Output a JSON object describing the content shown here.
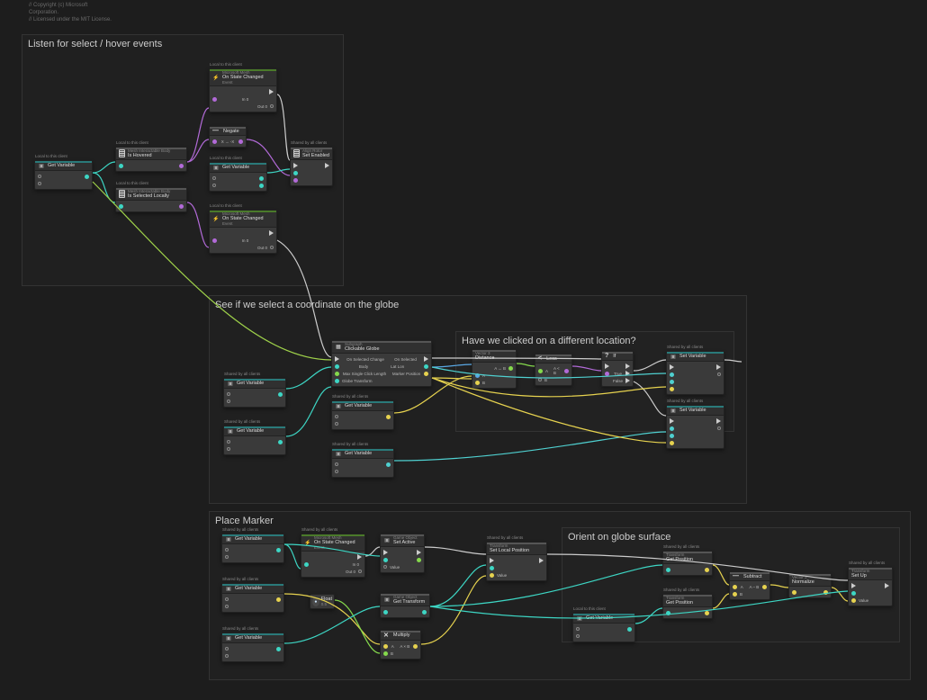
{
  "comments": [
    "// Copyright (c) Microsoft",
    "Corporation.",
    "// Licensed under the MIT License."
  ],
  "groups": {
    "g1": "Listen for select / hover events",
    "g2": "See if we select a coordinate on the globe",
    "g3": "Have we clicked on a different location?",
    "g4": "Place Marker",
    "g5": "Orient on globe surface"
  },
  "tags": {
    "local": "Local to this client",
    "shared": "Shared by all clients"
  },
  "nodes": {
    "onStateChanged": {
      "category": "Microsoft Mesh",
      "title": "On State Changed",
      "sub": "Event",
      "in": "In 0",
      "out": "Out 0"
    },
    "getVariable": "Get Variable",
    "setVariable": "Set Variable",
    "isHovered": {
      "category": "Mesh Interactable Body",
      "title": "Is Hovered"
    },
    "isSelectedLocally": {
      "category": "Mesh Interactable Body",
      "title": "Is Selected Locally"
    },
    "negate": {
      "title": "Negate",
      "sub": "X   → -X"
    },
    "setEnabled": {
      "category": "Align Rotor",
      "title": "Set Enabled"
    },
    "clickableGlobe": {
      "category": "Subgraph",
      "title": "Clickable Globe",
      "ports": {
        "onSelectedChange": "On Selected Change",
        "body": "Body",
        "maxSingleClickLength": "Max Single Click Length",
        "globeTransform": "Globe Transform",
        "onSelected": "On Selected",
        "latLon": "Lat Lon",
        "markerPosition": "Marker Position"
      }
    },
    "distance": {
      "category": "Vector 3",
      "title": "Distance",
      "a": "A",
      "b": "B",
      "out": "A ↔ B"
    },
    "less": {
      "title": "Less",
      "a": "A",
      "b": "B",
      "out": "A < B"
    },
    "if": {
      "title": "If",
      "true": "True",
      "false": "False"
    },
    "float": {
      "title": "Float",
      "value": "0.5"
    },
    "setActive": {
      "category": "Game Object",
      "title": "Set Active",
      "value": "Value"
    },
    "getTransform": {
      "category": "Game Object",
      "title": "Get Transform"
    },
    "multiply": {
      "title": "Multiply",
      "a": "A",
      "b": "B",
      "out": "A × B"
    },
    "setLocalPosition": {
      "category": "Transform",
      "title": "Set Local Position",
      "value": "Value"
    },
    "getPosition": {
      "category": "Transform",
      "title": "Get Position"
    },
    "subtract": {
      "title": "Subtract",
      "a": "A",
      "b": "B",
      "out": "A – B"
    },
    "normalize": {
      "category": "Vector 3",
      "title": "Normalize"
    },
    "setUp": {
      "category": "Transform",
      "title": "Set Up",
      "value": "Value"
    }
  }
}
